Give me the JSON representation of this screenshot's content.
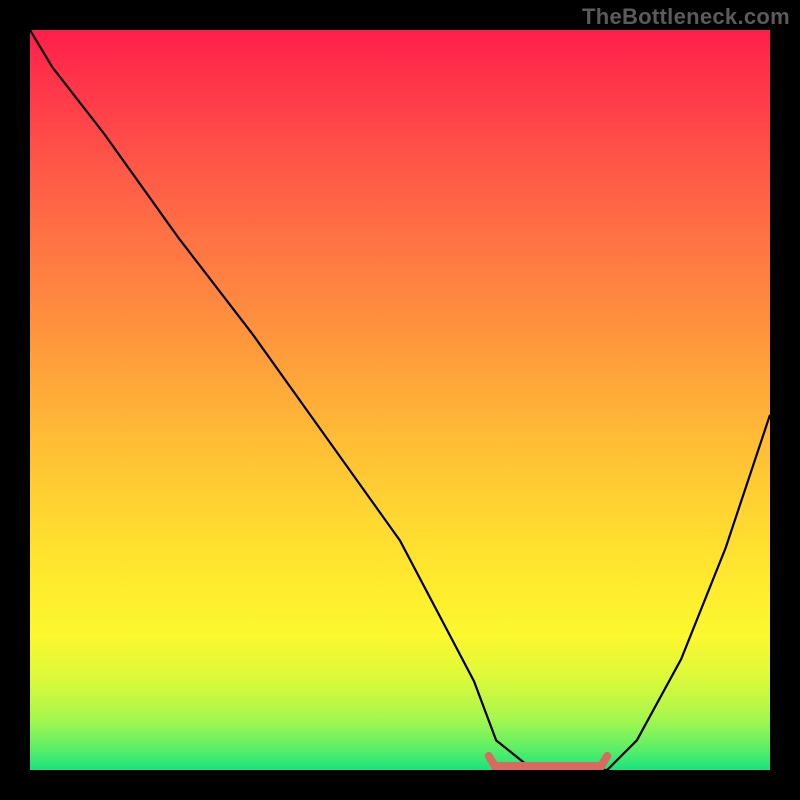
{
  "watermark": "TheBottleneck.com",
  "chart_data": {
    "type": "line",
    "title": "",
    "xlabel": "",
    "ylabel": "",
    "xlim": [
      0,
      100
    ],
    "ylim": [
      0,
      100
    ],
    "grid": false,
    "series": [
      {
        "name": "curve",
        "color": "#000000",
        "x": [
          0,
          3,
          10,
          20,
          30,
          40,
          50,
          60,
          63,
          68,
          75,
          78,
          82,
          88,
          94,
          100
        ],
        "values": [
          100,
          95,
          86,
          72,
          59,
          45,
          31,
          12,
          4,
          0,
          0,
          0,
          4,
          15,
          30,
          48
        ]
      }
    ],
    "highlight": {
      "color": "#d96a5f",
      "x_start": 62,
      "x_end": 78,
      "y": 0
    },
    "background_gradient": {
      "top": "#ff1f4b",
      "bottom": "#18e37e"
    }
  }
}
